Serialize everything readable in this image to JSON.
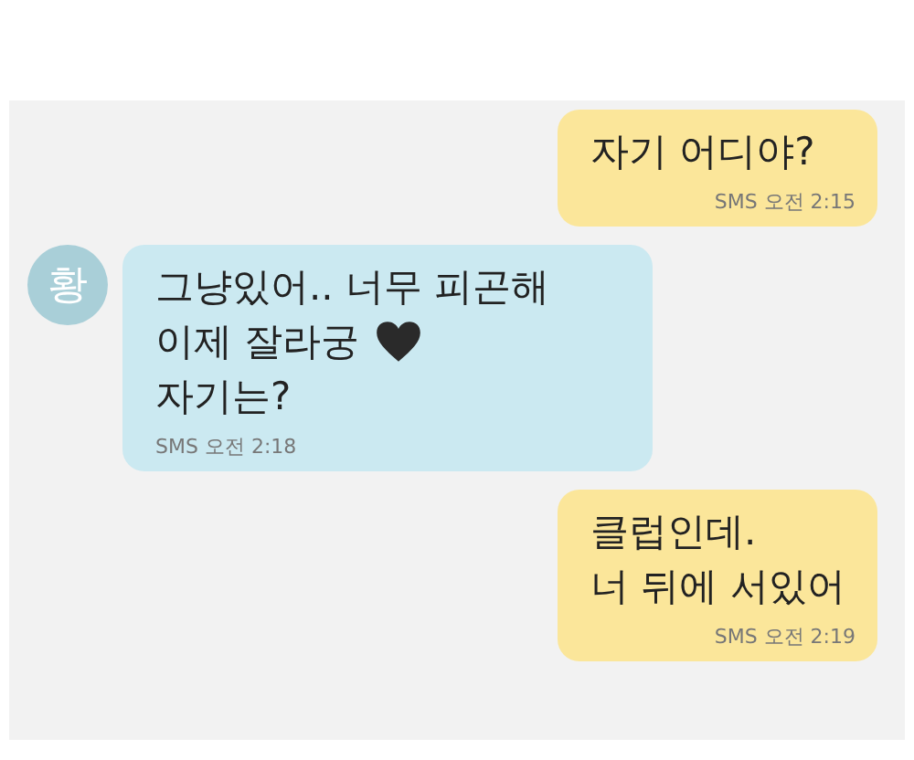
{
  "messages": [
    {
      "kind": "outgoing",
      "lines": [
        {
          "text": "자기 어디야?"
        }
      ],
      "meta": "SMS 오전 2:15"
    },
    {
      "kind": "incoming",
      "avatar": "황",
      "lines": [
        {
          "text": "그냥있어.. 너무 피곤해"
        },
        {
          "text": "이제 잘라궁",
          "heart": true
        },
        {
          "text": "자기는?"
        }
      ],
      "meta": "SMS 오전 2:18"
    },
    {
      "kind": "outgoing",
      "lines": [
        {
          "text": "클럽인데."
        },
        {
          "text": "너 뒤에 서있어"
        }
      ],
      "meta": "SMS 오전 2:19"
    }
  ]
}
